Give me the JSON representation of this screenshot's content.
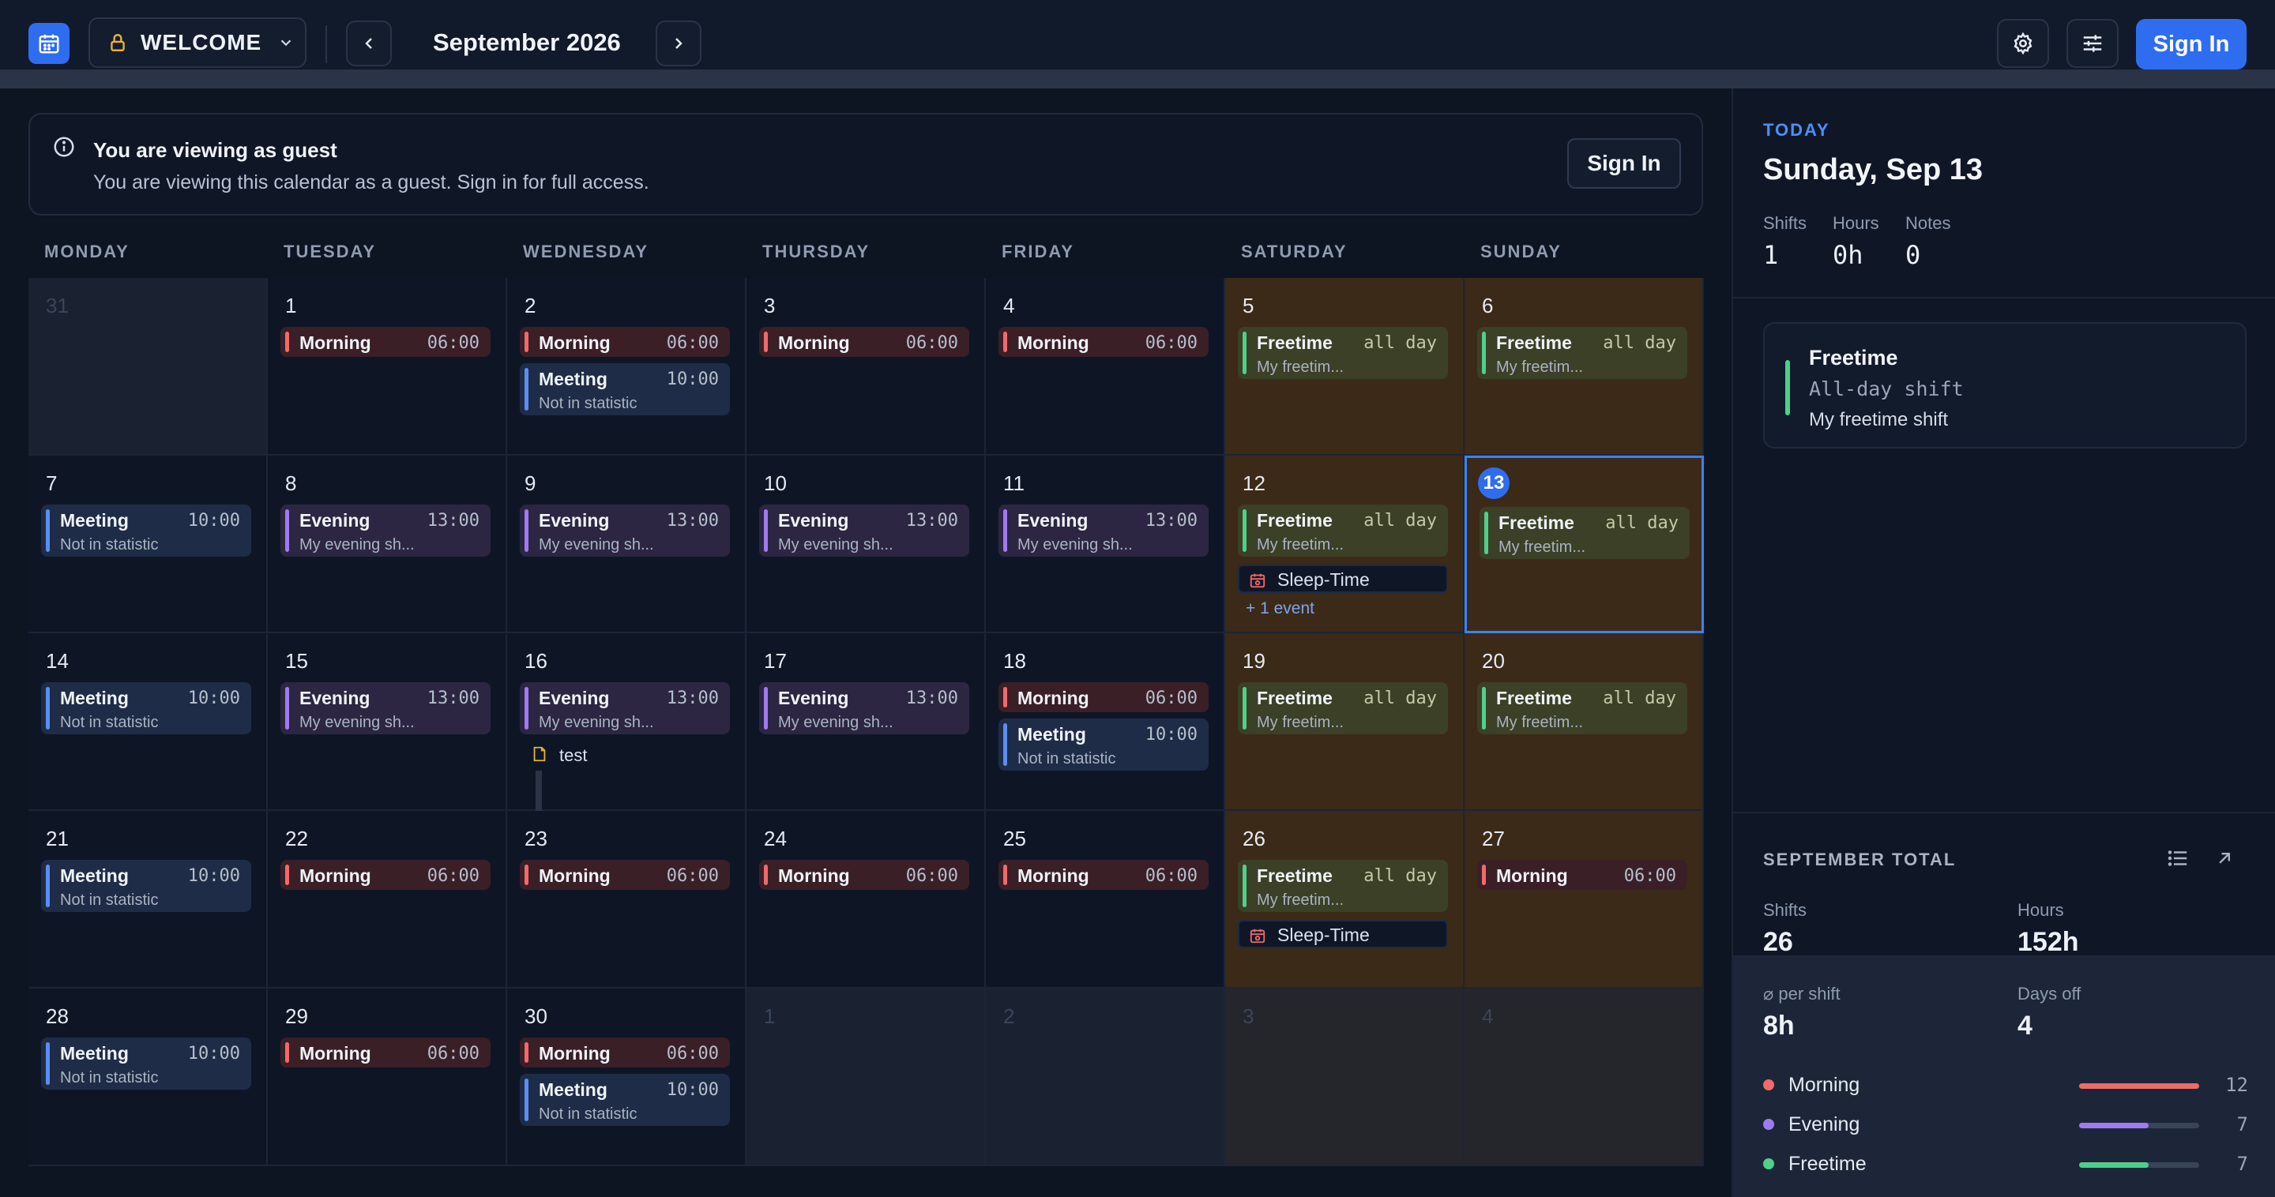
{
  "header": {
    "workspace_label": "WELCOME",
    "month_title": "September 2026",
    "sign_in_label": "Sign In"
  },
  "banner": {
    "title": "You are viewing as guest",
    "subtitle": "You are viewing this calendar as a guest. Sign in for full access.",
    "sign_in_label": "Sign In"
  },
  "calendar": {
    "weekdays": [
      "MONDAY",
      "TUESDAY",
      "WEDNESDAY",
      "THURSDAY",
      "FRIDAY",
      "SATURDAY",
      "SUNDAY"
    ],
    "today": "13",
    "weeks": [
      [
        {
          "day": "31",
          "other": true,
          "events": []
        },
        {
          "day": "1",
          "events": [
            {
              "kind": "morning",
              "name": "Morning",
              "time": "06:00"
            }
          ]
        },
        {
          "day": "2",
          "events": [
            {
              "kind": "morning",
              "name": "Morning",
              "time": "06:00"
            },
            {
              "kind": "meeting",
              "name": "Meeting",
              "time": "10:00",
              "sub": "Not in statistic"
            }
          ]
        },
        {
          "day": "3",
          "events": [
            {
              "kind": "morning",
              "name": "Morning",
              "time": "06:00"
            }
          ]
        },
        {
          "day": "4",
          "events": [
            {
              "kind": "morning",
              "name": "Morning",
              "time": "06:00"
            }
          ]
        },
        {
          "day": "5",
          "events": [
            {
              "kind": "freetime",
              "name": "Freetime",
              "time": "all day",
              "sub": "My freetim..."
            }
          ]
        },
        {
          "day": "6",
          "events": [
            {
              "kind": "freetime",
              "name": "Freetime",
              "time": "all day",
              "sub": "My freetim..."
            }
          ]
        }
      ],
      [
        {
          "day": "7",
          "events": [
            {
              "kind": "meeting",
              "name": "Meeting",
              "time": "10:00",
              "sub": "Not in statistic"
            }
          ]
        },
        {
          "day": "8",
          "events": [
            {
              "kind": "evening",
              "name": "Evening",
              "time": "13:00",
              "sub": "My evening sh..."
            }
          ]
        },
        {
          "day": "9",
          "events": [
            {
              "kind": "evening",
              "name": "Evening",
              "time": "13:00",
              "sub": "My evening sh..."
            }
          ]
        },
        {
          "day": "10",
          "events": [
            {
              "kind": "evening",
              "name": "Evening",
              "time": "13:00",
              "sub": "My evening sh..."
            }
          ]
        },
        {
          "day": "11",
          "events": [
            {
              "kind": "evening",
              "name": "Evening",
              "time": "13:00",
              "sub": "My evening sh..."
            }
          ]
        },
        {
          "day": "12",
          "events": [
            {
              "kind": "freetime",
              "name": "Freetime",
              "time": "all day",
              "sub": "My freetim..."
            },
            {
              "kind": "sleep",
              "name": "Sleep-Time"
            }
          ],
          "more": "+ 1 event"
        },
        {
          "day": "13",
          "events": [
            {
              "kind": "freetime",
              "name": "Freetime",
              "time": "all day",
              "sub": "My freetim..."
            }
          ]
        }
      ],
      [
        {
          "day": "14",
          "events": [
            {
              "kind": "meeting",
              "name": "Meeting",
              "time": "10:00",
              "sub": "Not in statistic"
            }
          ]
        },
        {
          "day": "15",
          "events": [
            {
              "kind": "evening",
              "name": "Evening",
              "time": "13:00",
              "sub": "My evening sh..."
            }
          ]
        },
        {
          "day": "16",
          "events": [
            {
              "kind": "evening",
              "name": "Evening",
              "time": "13:00",
              "sub": "My evening sh..."
            },
            {
              "kind": "note",
              "name": "test"
            }
          ]
        },
        {
          "day": "17",
          "events": [
            {
              "kind": "evening",
              "name": "Evening",
              "time": "13:00",
              "sub": "My evening sh..."
            }
          ]
        },
        {
          "day": "18",
          "events": [
            {
              "kind": "morning",
              "name": "Morning",
              "time": "06:00"
            },
            {
              "kind": "meeting",
              "name": "Meeting",
              "time": "10:00",
              "sub": "Not in statistic"
            }
          ]
        },
        {
          "day": "19",
          "events": [
            {
              "kind": "freetime",
              "name": "Freetime",
              "time": "all day",
              "sub": "My freetim..."
            }
          ]
        },
        {
          "day": "20",
          "events": [
            {
              "kind": "freetime",
              "name": "Freetime",
              "time": "all day",
              "sub": "My freetim..."
            }
          ]
        }
      ],
      [
        {
          "day": "21",
          "events": [
            {
              "kind": "meeting",
              "name": "Meeting",
              "time": "10:00",
              "sub": "Not in statistic"
            }
          ]
        },
        {
          "day": "22",
          "events": [
            {
              "kind": "morning",
              "name": "Morning",
              "time": "06:00"
            }
          ]
        },
        {
          "day": "23",
          "events": [
            {
              "kind": "morning",
              "name": "Morning",
              "time": "06:00"
            }
          ]
        },
        {
          "day": "24",
          "events": [
            {
              "kind": "morning",
              "name": "Morning",
              "time": "06:00"
            }
          ]
        },
        {
          "day": "25",
          "events": [
            {
              "kind": "morning",
              "name": "Morning",
              "time": "06:00"
            }
          ]
        },
        {
          "day": "26",
          "events": [
            {
              "kind": "freetime",
              "name": "Freetime",
              "time": "all day",
              "sub": "My freetim..."
            },
            {
              "kind": "sleep",
              "name": "Sleep-Time"
            }
          ]
        },
        {
          "day": "27",
          "events": [
            {
              "kind": "morning",
              "name": "Morning",
              "time": "06:00"
            }
          ]
        }
      ],
      [
        {
          "day": "28",
          "events": [
            {
              "kind": "meeting",
              "name": "Meeting",
              "time": "10:00",
              "sub": "Not in statistic"
            }
          ]
        },
        {
          "day": "29",
          "events": [
            {
              "kind": "morning",
              "name": "Morning",
              "time": "06:00"
            }
          ]
        },
        {
          "day": "30",
          "events": [
            {
              "kind": "morning",
              "name": "Morning",
              "time": "06:00"
            },
            {
              "kind": "meeting",
              "name": "Meeting",
              "time": "10:00",
              "sub": "Not in statistic"
            }
          ]
        },
        {
          "day": "1",
          "other": true,
          "events": []
        },
        {
          "day": "2",
          "other": true,
          "events": []
        },
        {
          "day": "3",
          "other": true,
          "events": []
        },
        {
          "day": "4",
          "other": true,
          "events": []
        }
      ]
    ]
  },
  "today_panel": {
    "label": "TODAY",
    "date": "Sunday, Sep 13",
    "stats": [
      {
        "label": "Shifts",
        "value": "1"
      },
      {
        "label": "Hours",
        "value": "0h"
      },
      {
        "label": "Notes",
        "value": "0"
      }
    ],
    "shift_card": {
      "title": "Freetime",
      "subtitle": "All-day shift",
      "note": "My freetime shift"
    }
  },
  "month_total": {
    "label": "SEPTEMBER TOTAL",
    "stats": [
      {
        "label": "Shifts",
        "value": "26"
      },
      {
        "label": "Hours",
        "value": "152h"
      },
      {
        "label": "⌀ per shift",
        "value": "8h"
      },
      {
        "label": "Days off",
        "value": "4"
      }
    ],
    "legend": [
      {
        "name": "Morning",
        "count": "12",
        "fraction": 1.0,
        "color": "#f06a6a"
      },
      {
        "name": "Evening",
        "count": "7",
        "fraction": 0.58,
        "color": "#a07af0"
      },
      {
        "name": "Freetime",
        "count": "7",
        "fraction": 0.58,
        "color": "#4fd08a"
      }
    ]
  },
  "colors": {
    "accent": "#2f6df0",
    "morning": "#f06a6a",
    "evening": "#a07af0",
    "meeting": "#5b8ef0",
    "freetime": "#4fd08a",
    "weekend": "#3b2a17"
  }
}
